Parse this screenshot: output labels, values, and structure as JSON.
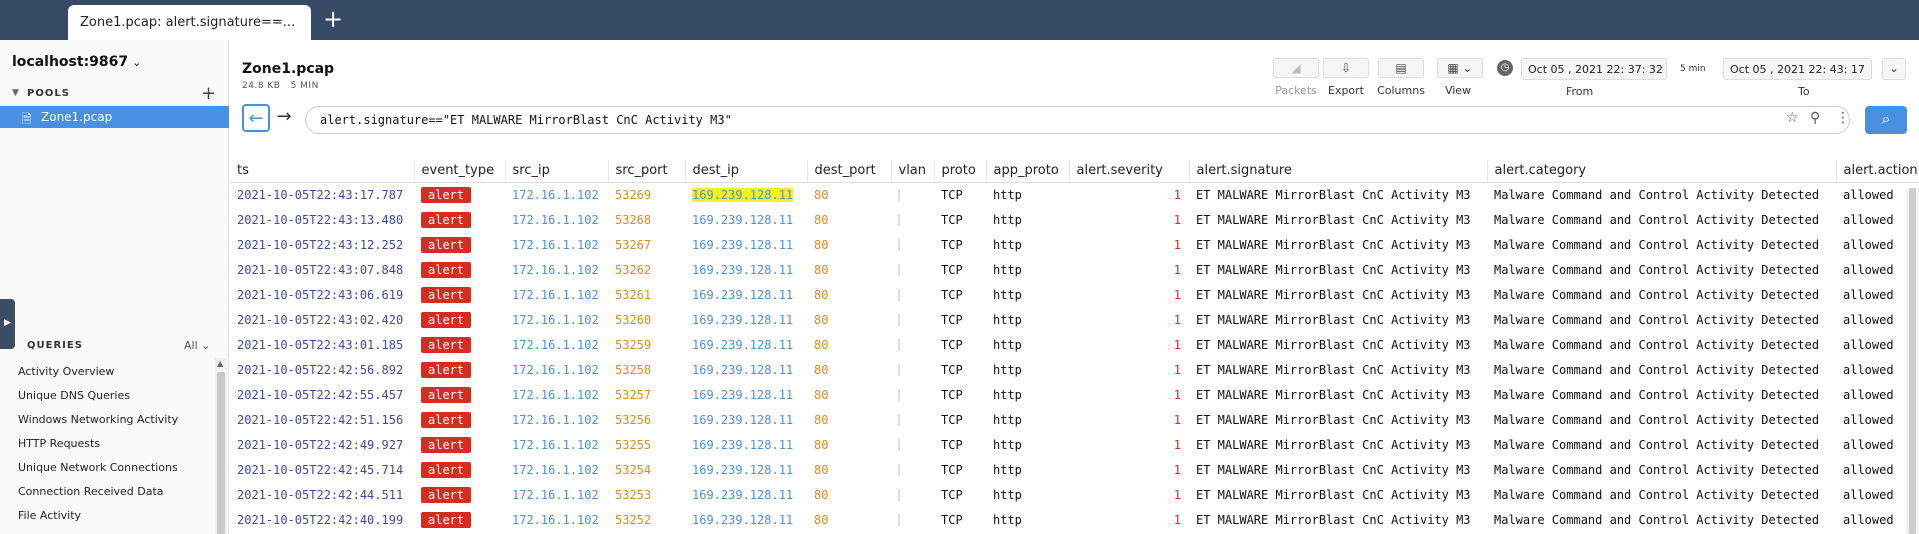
{
  "window": {
    "tab_title": "Zone1.pcap: alert.signature==...",
    "new_tab": "+"
  },
  "sidebar": {
    "host": "localhost:9867",
    "pools_label": "POOLS",
    "pools": [
      {
        "name": "Zone1.pcap"
      }
    ],
    "queries_label": "QUERIES",
    "queries_filter": "All",
    "queries": [
      "Activity Overview",
      "Unique DNS Queries",
      "Windows Networking Activity",
      "HTTP Requests",
      "Unique Network Connections",
      "Connection Received Data",
      "File Activity"
    ]
  },
  "header": {
    "title": "Zone1.pcap",
    "size": "24.8 KB",
    "duration": "5 MIN",
    "toolbar": {
      "packets": "Packets",
      "export": "Export",
      "columns": "Columns",
      "view": "View"
    },
    "time": {
      "from": "Oct  05 , 2021   22: 37: 32",
      "to": "Oct  05 , 2021   22: 43: 17",
      "span": "5 min",
      "from_label": "From",
      "to_label": "To"
    }
  },
  "search": {
    "query": "alert.signature==\"ET MALWARE MirrorBlast CnC Activity M3\""
  },
  "table": {
    "columns": [
      "ts",
      "event_type",
      "src_ip",
      "src_port",
      "dest_ip",
      "dest_port",
      "vlan",
      "proto",
      "app_proto",
      "alert.severity",
      "alert.signature",
      "alert.category",
      "alert.action"
    ],
    "rows": [
      [
        "2021-10-05T22:43:17.787",
        "alert",
        "172.16.1.102",
        "53269",
        "169.239.128.11",
        "80",
        "",
        "TCP",
        "http",
        "1",
        "ET MALWARE MirrorBlast CnC Activity M3",
        "Malware Command and Control Activity Detected",
        "allowed"
      ],
      [
        "2021-10-05T22:43:13.480",
        "alert",
        "172.16.1.102",
        "53268",
        "169.239.128.11",
        "80",
        "",
        "TCP",
        "http",
        "1",
        "ET MALWARE MirrorBlast CnC Activity M3",
        "Malware Command and Control Activity Detected",
        "allowed"
      ],
      [
        "2021-10-05T22:43:12.252",
        "alert",
        "172.16.1.102",
        "53267",
        "169.239.128.11",
        "80",
        "",
        "TCP",
        "http",
        "1",
        "ET MALWARE MirrorBlast CnC Activity M3",
        "Malware Command and Control Activity Detected",
        "allowed"
      ],
      [
        "2021-10-05T22:43:07.848",
        "alert",
        "172.16.1.102",
        "53262",
        "169.239.128.11",
        "80",
        "",
        "TCP",
        "http",
        "1",
        "ET MALWARE MirrorBlast CnC Activity M3",
        "Malware Command and Control Activity Detected",
        "allowed"
      ],
      [
        "2021-10-05T22:43:06.619",
        "alert",
        "172.16.1.102",
        "53261",
        "169.239.128.11",
        "80",
        "",
        "TCP",
        "http",
        "1",
        "ET MALWARE MirrorBlast CnC Activity M3",
        "Malware Command and Control Activity Detected",
        "allowed"
      ],
      [
        "2021-10-05T22:43:02.420",
        "alert",
        "172.16.1.102",
        "53260",
        "169.239.128.11",
        "80",
        "",
        "TCP",
        "http",
        "1",
        "ET MALWARE MirrorBlast CnC Activity M3",
        "Malware Command and Control Activity Detected",
        "allowed"
      ],
      [
        "2021-10-05T22:43:01.185",
        "alert",
        "172.16.1.102",
        "53259",
        "169.239.128.11",
        "80",
        "",
        "TCP",
        "http",
        "1",
        "ET MALWARE MirrorBlast CnC Activity M3",
        "Malware Command and Control Activity Detected",
        "allowed"
      ],
      [
        "2021-10-05T22:42:56.892",
        "alert",
        "172.16.1.102",
        "53258",
        "169.239.128.11",
        "80",
        "",
        "TCP",
        "http",
        "1",
        "ET MALWARE MirrorBlast CnC Activity M3",
        "Malware Command and Control Activity Detected",
        "allowed"
      ],
      [
        "2021-10-05T22:42:55.457",
        "alert",
        "172.16.1.102",
        "53257",
        "169.239.128.11",
        "80",
        "",
        "TCP",
        "http",
        "1",
        "ET MALWARE MirrorBlast CnC Activity M3",
        "Malware Command and Control Activity Detected",
        "allowed"
      ],
      [
        "2021-10-05T22:42:51.156",
        "alert",
        "172.16.1.102",
        "53256",
        "169.239.128.11",
        "80",
        "",
        "TCP",
        "http",
        "1",
        "ET MALWARE MirrorBlast CnC Activity M3",
        "Malware Command and Control Activity Detected",
        "allowed"
      ],
      [
        "2021-10-05T22:42:49.927",
        "alert",
        "172.16.1.102",
        "53255",
        "169.239.128.11",
        "80",
        "",
        "TCP",
        "http",
        "1",
        "ET MALWARE MirrorBlast CnC Activity M3",
        "Malware Command and Control Activity Detected",
        "allowed"
      ],
      [
        "2021-10-05T22:42:45.714",
        "alert",
        "172.16.1.102",
        "53254",
        "169.239.128.11",
        "80",
        "",
        "TCP",
        "http",
        "1",
        "ET MALWARE MirrorBlast CnC Activity M3",
        "Malware Command and Control Activity Detected",
        "allowed"
      ],
      [
        "2021-10-05T22:42:44.511",
        "alert",
        "172.16.1.102",
        "53253",
        "169.239.128.11",
        "80",
        "",
        "TCP",
        "http",
        "1",
        "ET MALWARE MirrorBlast CnC Activity M3",
        "Malware Command and Control Activity Detected",
        "allowed"
      ],
      [
        "2021-10-05T22:42:40.199",
        "alert",
        "172.16.1.102",
        "53252",
        "169.239.128.11",
        "80",
        "",
        "TCP",
        "http",
        "1",
        "ET MALWARE MirrorBlast CnC Activity M3",
        "Malware Command and Control Activity Detected",
        "allowed"
      ]
    ],
    "highlight_cell": {
      "row": 0,
      "col": 4
    }
  },
  "colors": {
    "titlebar": "#364a66",
    "accent": "#4a90e2",
    "alert": "#d62d20",
    "port": "#e08a1e",
    "ts": "#3d4aa6",
    "highlight": "#f3f31a"
  },
  "icons": [
    "shark-fin-icon",
    "export-icon",
    "columns-icon",
    "view-icon",
    "clock-icon",
    "back-arrow-icon",
    "forward-arrow-icon",
    "star-icon",
    "pin-icon",
    "kebab-icon",
    "search-icon",
    "file-icon",
    "plus-icon",
    "chevron-down-icon"
  ]
}
